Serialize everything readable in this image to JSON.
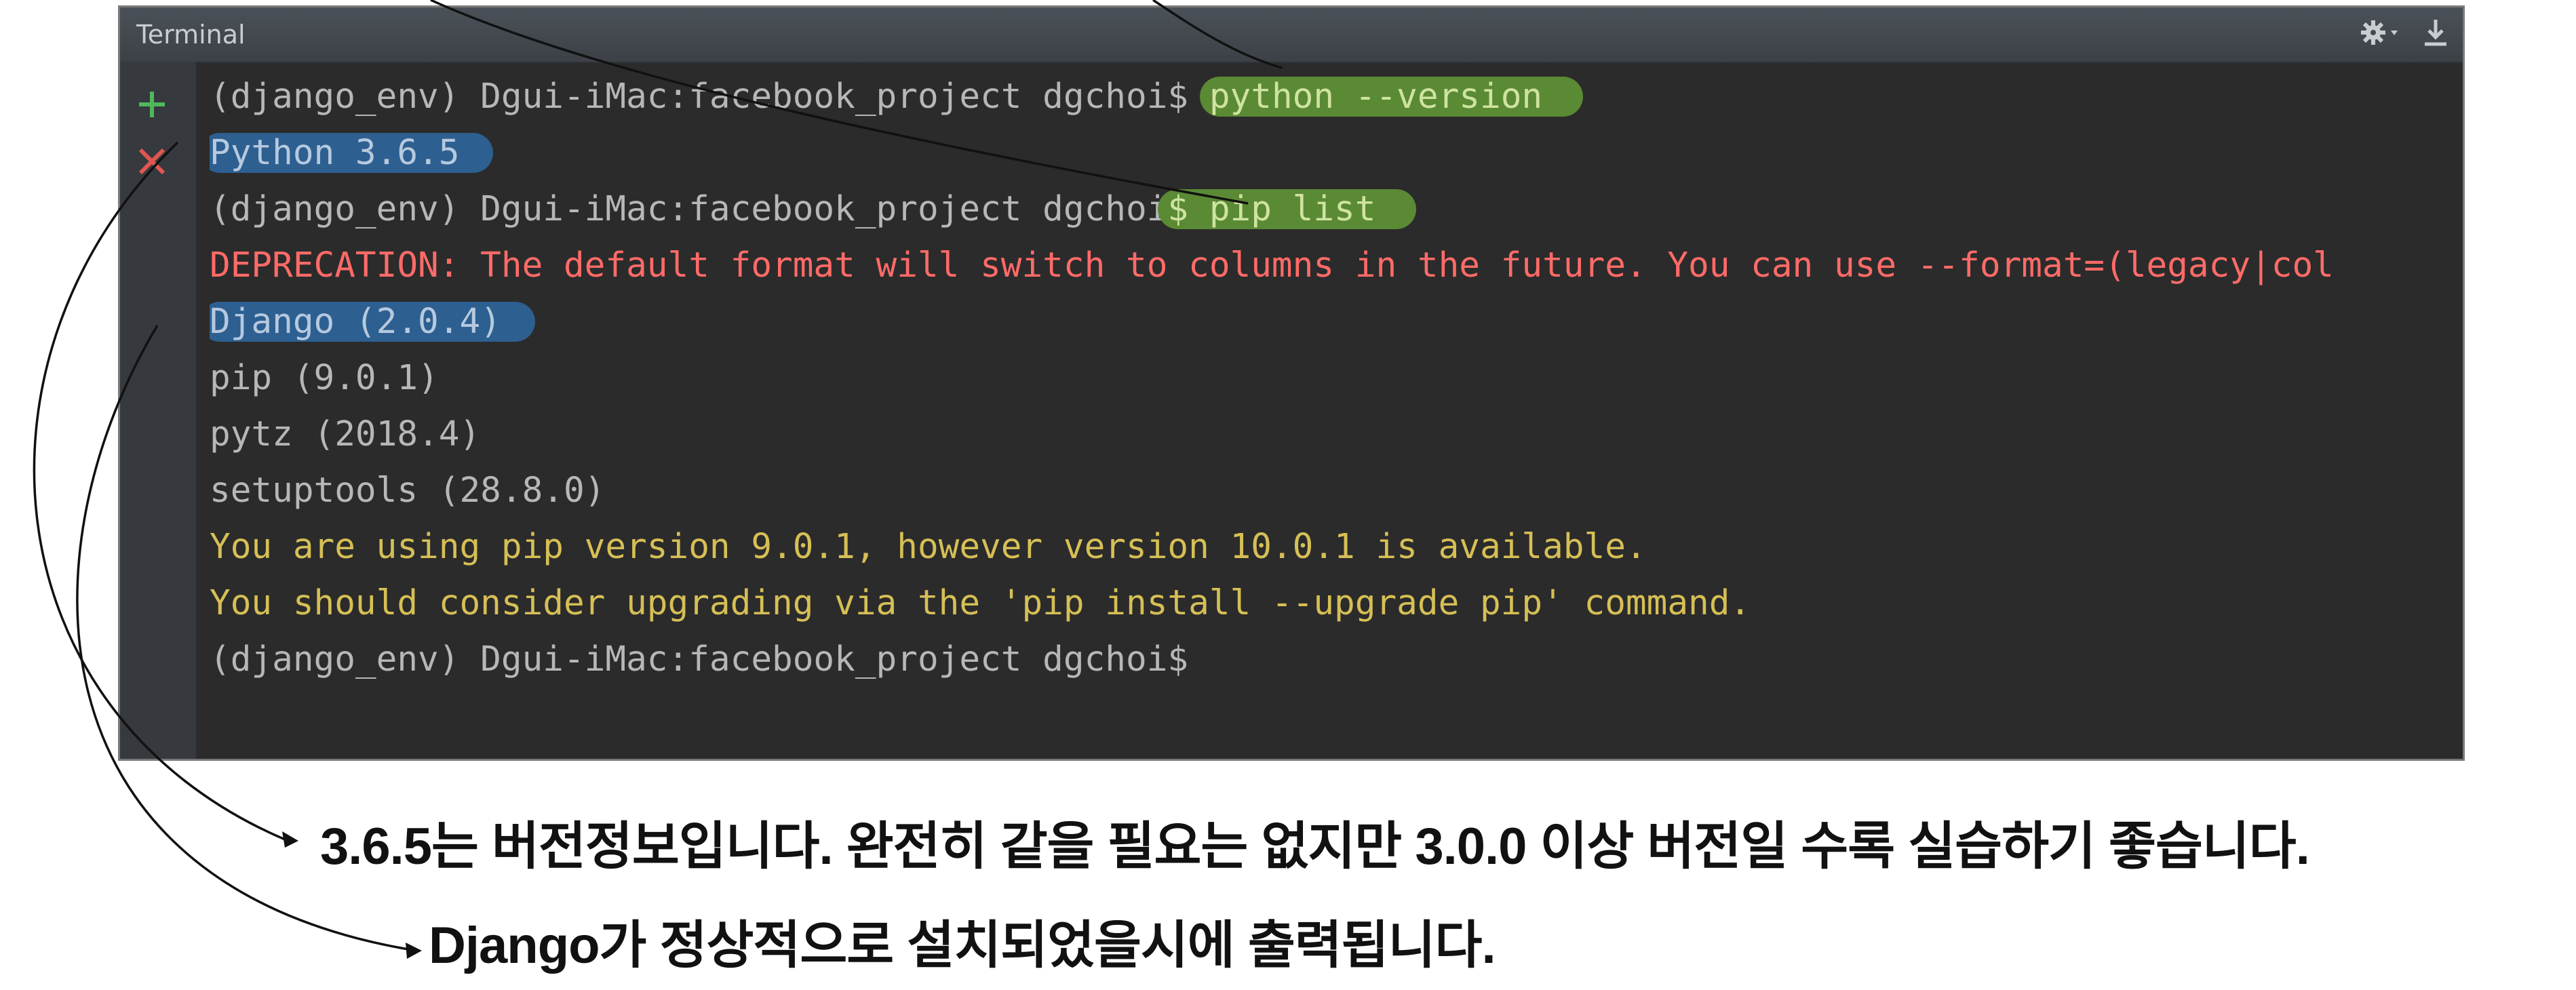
{
  "terminal": {
    "title": "Terminal",
    "toolbar": {
      "gear_icon": "gear-icon",
      "download_icon": "hide-icon"
    },
    "gutter": {
      "add_icon": "plus-icon",
      "close_icon": "close-icon"
    },
    "lines": [
      {
        "prompt": "(django_env) Dgui-iMac:facebook_project dgchoi$ ",
        "command": "python --version"
      },
      {
        "text": "Python 3.6.5"
      },
      {
        "prompt": "(django_env) Dgui-iMac:facebook_project dgchoi",
        "command": "$ pip list"
      },
      {
        "text": "DEPRECATION: The default format will switch to columns in the future. You can use --format=(legacy|col"
      },
      {
        "text": "Django (2.0.4)"
      },
      {
        "text": "pip (9.0.1)"
      },
      {
        "text": "pytz (2018.4)"
      },
      {
        "text": "setuptools (28.8.0)"
      },
      {
        "text": "You are using pip version 9.0.1, however version 10.0.1 is available."
      },
      {
        "text": "You should consider upgrading via the 'pip install --upgrade pip' command."
      },
      {
        "text": "(django_env) Dgui-iMac:facebook_project dgchoi$"
      }
    ]
  },
  "annotations": {
    "version_note": "3.6.5는 버전정보입니다. 완전히 같을 필요는 없지만 3.0.0 이상 버전일 수록 실습하기 좋습니다.",
    "django_note": "Django가 정상적으로 설치되었을시에 출력됩니다."
  },
  "colors": {
    "terminal_bg": "#2b2b2b",
    "command_highlight": "#5a8a34",
    "output_highlight": "#2d5f91",
    "error_text": "#ff6b68",
    "warning_text": "#d6bf55"
  }
}
